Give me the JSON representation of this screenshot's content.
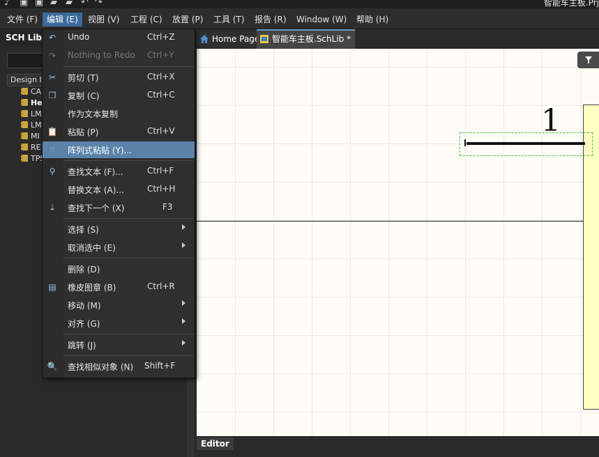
{
  "window": {
    "title": "智能车主板.Prj"
  },
  "menubar": {
    "items": [
      {
        "label": "文件 (F)"
      },
      {
        "label": "编辑 (E)"
      },
      {
        "label": "视图 (V)"
      },
      {
        "label": "工程 (C)"
      },
      {
        "label": "放置 (P)"
      },
      {
        "label": "工具 (T)"
      },
      {
        "label": "报告 (R)"
      },
      {
        "label": "Window (W)"
      },
      {
        "label": "帮助 (H)"
      }
    ]
  },
  "left_panel": {
    "title": "SCH Libra",
    "design_items_label": "Design It",
    "items": [
      {
        "label": "CA"
      },
      {
        "label": "He"
      },
      {
        "label": "LM"
      },
      {
        "label": "LM"
      },
      {
        "label": "MI"
      },
      {
        "label": "RE"
      },
      {
        "label": "TPS"
      }
    ]
  },
  "tabs": [
    {
      "label": "Home Page"
    },
    {
      "label": "智能车主板.SchLib *"
    }
  ],
  "canvas": {
    "pin_number": "1"
  },
  "editor_tab": {
    "label": "Editor"
  },
  "edit_menu": {
    "items": [
      {
        "label": "Undo",
        "shortcut": "Ctrl+Z",
        "icon": "undo-icon"
      },
      {
        "label": "Nothing to Redo",
        "shortcut": "Ctrl+Y",
        "icon": "redo-icon",
        "disabled": true
      },
      {
        "label": "剪切 (T)",
        "shortcut": "Ctrl+X",
        "icon": "cut-icon"
      },
      {
        "label": "复制 (C)",
        "shortcut": "Ctrl+C",
        "icon": "copy-icon"
      },
      {
        "label": "作为文本复制",
        "shortcut": ""
      },
      {
        "label": "粘贴 (P)",
        "shortcut": "Ctrl+V",
        "icon": "paste-icon"
      },
      {
        "label": "阵列式粘贴 (Y)...",
        "shortcut": "",
        "icon": "array-paste-icon",
        "highlighted": true
      },
      {
        "label": "查找文本 (F)...",
        "shortcut": "Ctrl+F",
        "icon": "binoculars-icon"
      },
      {
        "label": "替换文本 (A)...",
        "shortcut": "Ctrl+H"
      },
      {
        "label": "查找下一个 (X)",
        "shortcut": "F3",
        "icon": "find-next-icon"
      },
      {
        "label": "选择 (S)",
        "submenu": true
      },
      {
        "label": "取消选中 (E)",
        "submenu": true
      },
      {
        "label": "删除 (D)",
        "shortcut": ""
      },
      {
        "label": "橡皮图章 (B)",
        "shortcut": "Ctrl+R",
        "icon": "rubber-stamp-icon"
      },
      {
        "label": "移动 (M)",
        "submenu": true
      },
      {
        "label": "对齐 (G)",
        "submenu": true
      },
      {
        "label": "跳转 (J)",
        "submenu": true
      },
      {
        "label": "查找相似对象 (N)",
        "shortcut": "Shift+F",
        "icon": "magnifier-icon"
      }
    ]
  }
}
